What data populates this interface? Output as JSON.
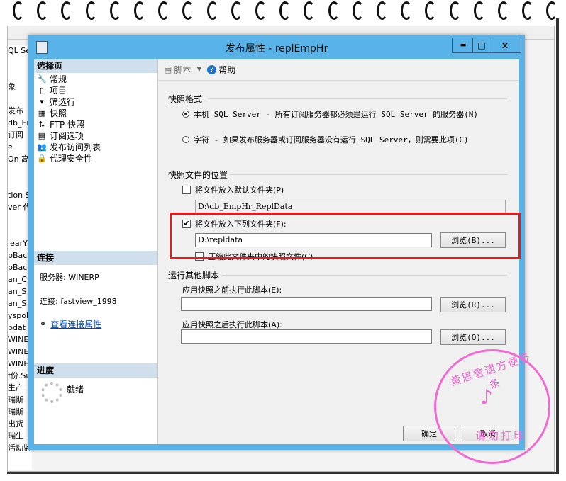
{
  "background_window": {
    "left_fragments": [
      "QL Se",
      "",
      "",
      "象",
      "",
      "发布",
      "db_En",
      "订阅",
      "e",
      "On 高",
      "",
      "",
      "tion S",
      "ver 代",
      "",
      "",
      "learY",
      "bBac",
      "bBac",
      "an_C",
      "an_S",
      "an_S",
      "yspoli",
      "pdat",
      "WINEF",
      "WINEF",
      "WINEF",
      "f份.Su",
      "生产",
      "瑞斯",
      "瑞斯",
      "出货",
      "瑞生",
      "活动监"
    ]
  },
  "dialog": {
    "title": "发布属性 - replEmpHr",
    "controls": {
      "minimize": "▬",
      "maximize": "□",
      "close": "x"
    },
    "left": {
      "select_page_header": "选择页",
      "nav_items": [
        {
          "label": "常规",
          "icon": "wrench-icon"
        },
        {
          "label": "项目",
          "icon": "document-icon"
        },
        {
          "label": "筛选行",
          "icon": "filter-icon"
        },
        {
          "label": "快照",
          "icon": "snapshot-icon"
        },
        {
          "label": "FTP 快照",
          "icon": "ftp-icon"
        },
        {
          "label": "订阅选项",
          "icon": "subscription-icon"
        },
        {
          "label": "发布访问列表",
          "icon": "users-icon"
        },
        {
          "label": "代理安全性",
          "icon": "lock-icon"
        }
      ],
      "connection_header": "连接",
      "server": "服务器: WINERP",
      "connection": "连接: fastview_1998",
      "view_connection_link": "查看连接属性",
      "progress_header": "进度",
      "status": "就绪"
    },
    "toolbar": {
      "script_label": "脚本",
      "help_label": "帮助"
    },
    "snapshot_format": {
      "title": "快照格式",
      "option_native": "本机 SQL Server - 所有订阅服务器都必须是运行 SQL Server 的服务器(N)",
      "option_character": "字符 - 如果发布服务器或订阅服务器没有运行 SQL Server，则需要此项(C)",
      "selected": "native"
    },
    "snapshot_location": {
      "title": "快照文件的位置",
      "default_folder_label": "将文件放入默认文件夹(P)",
      "default_folder_checked": false,
      "default_folder_path": "D:\\db_EmpHr_ReplData",
      "custom_folder_label": "将文件放入下列文件夹(F):",
      "custom_folder_checked": true,
      "custom_folder_path": "D:\\repldata",
      "browse_label": "浏览(B)...",
      "compress_label": "压缩此文件夹中的快照文件(C)",
      "compress_checked": false
    },
    "scripts": {
      "title": "运行其他脚本",
      "before_label": "应用快照之前执行此脚本(E):",
      "before_value": "",
      "before_browse": "浏览(R)...",
      "after_label": "应用快照之后执行此脚本(A):",
      "after_value": "",
      "after_browse": "浏览(O)..."
    },
    "footer": {
      "ok_label": "确定",
      "cancel_label": "取消"
    }
  },
  "stamp": {
    "text_top": "黄思雪遗方便签条",
    "text_bottom": "请勿打印"
  },
  "colors": {
    "title_bar": "#5ab3e8",
    "section_header": "#cfdfec",
    "highlight_box": "#e21c1c",
    "stamp": "#f06ad2"
  }
}
